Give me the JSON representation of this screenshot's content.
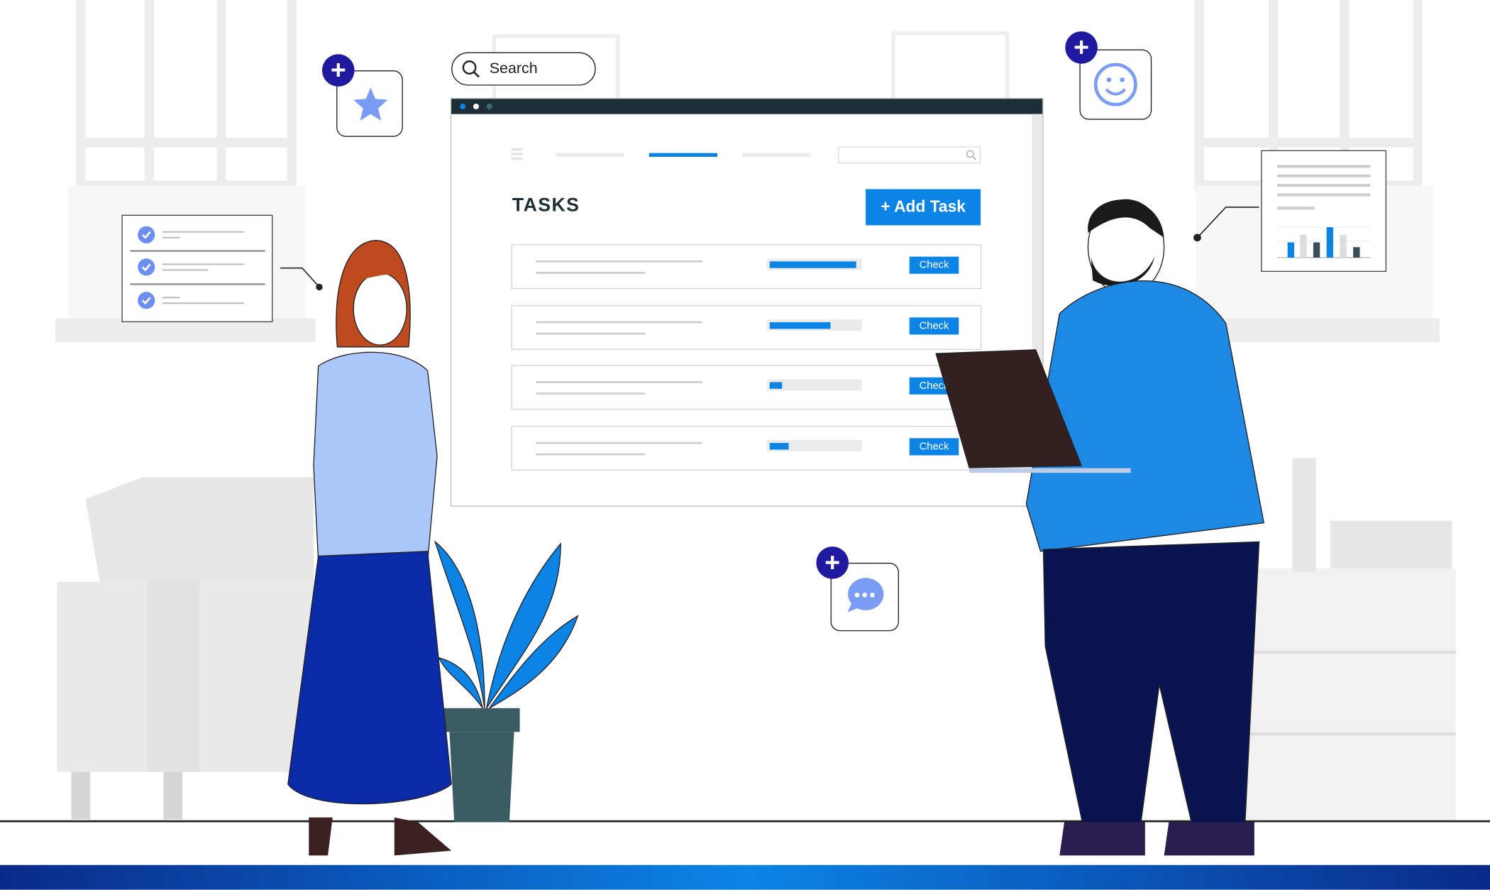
{
  "search": {
    "label": "Search",
    "icon": "search-icon"
  },
  "browser": {
    "title_dots": [
      "#0b84e6",
      "#ffffff",
      "#3b6a72"
    ],
    "nav": {
      "active_tab_index": 1
    },
    "page_title": "TASKS",
    "add_button": "+ Add Task",
    "tasks": [
      {
        "progress": 0.97,
        "action": "Check"
      },
      {
        "progress": 0.68,
        "action": "Check"
      },
      {
        "progress": 0.14,
        "action": "Check"
      },
      {
        "progress": 0.21,
        "action": "Check"
      }
    ]
  },
  "floating_cards": [
    {
      "icon": "star-icon"
    },
    {
      "icon": "smiley-icon"
    },
    {
      "icon": "chat-bubble-icon"
    },
    {
      "icon": "checklist-icon"
    },
    {
      "icon": "bar-chart-icon"
    }
  ],
  "colors": {
    "accent": "#0b84e6",
    "navy": "#1f1aa0",
    "dark": "#1e2e36"
  }
}
